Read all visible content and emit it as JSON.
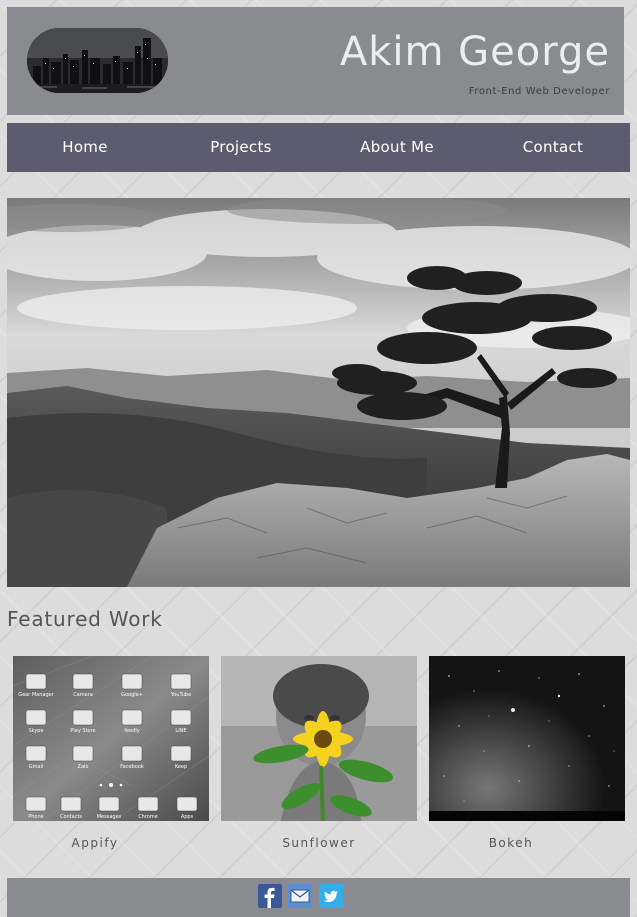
{
  "header": {
    "title": "Akim George",
    "subtitle": "Front-End Web Developer"
  },
  "nav": {
    "items": [
      {
        "label": "Home"
      },
      {
        "label": "Projects"
      },
      {
        "label": "About Me"
      },
      {
        "label": "Contact"
      }
    ]
  },
  "featured": {
    "title": "Featured Work",
    "items": [
      {
        "label": "Appify"
      },
      {
        "label": "Sunflower"
      },
      {
        "label": "Bokeh"
      }
    ]
  },
  "appify_icons": [
    "Gear Manager",
    "Camera",
    "Google+",
    "YouTube",
    "Skype",
    "Play Store",
    "feedly",
    "LINE",
    "Gmail",
    "Zalo",
    "Facebook",
    "Keep",
    "Phone",
    "Contacts",
    "Messages",
    "Chrome",
    "Apps"
  ],
  "footer": {
    "icons": [
      "facebook-icon",
      "email-icon",
      "twitter-icon"
    ]
  },
  "colors": {
    "header_bg": "#8a8a92",
    "nav_bg": "#5d5c6e",
    "title_color": "#ececf4",
    "facebook": "#3b5998",
    "twitter": "#33aee8"
  }
}
